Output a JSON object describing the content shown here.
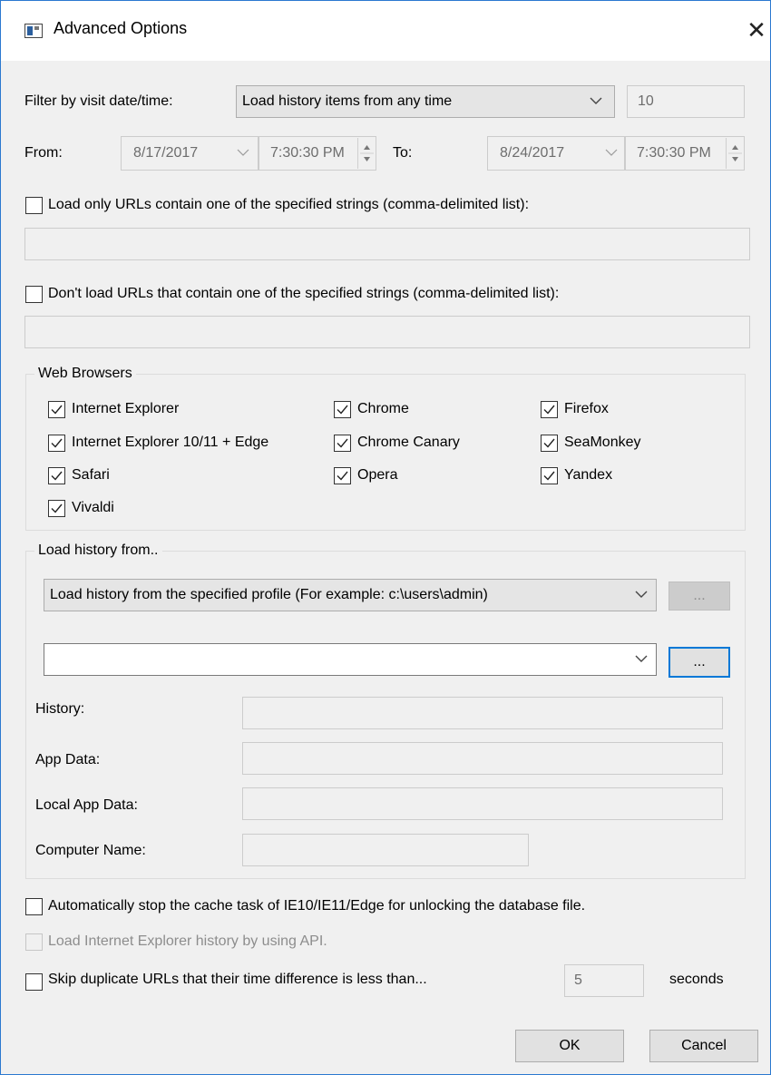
{
  "window": {
    "title": "Advanced Options",
    "close_glyph": "✕"
  },
  "filter": {
    "label": "Filter by visit date/time:",
    "selected": "Load history items from any time",
    "number_value": "10"
  },
  "range": {
    "from_label": "From:",
    "from_date": "8/17/2017",
    "from_time": "7:30:30 PM",
    "to_label": "To:",
    "to_date": "8/24/2017",
    "to_time": "7:30:30 PM"
  },
  "include_urls": {
    "label": "Load only URLs contain one of the specified strings (comma-delimited list):",
    "checked": false,
    "value": ""
  },
  "exclude_urls": {
    "label": "Don't load URLs that contain one of the specified strings (comma-delimited list):",
    "checked": false,
    "value": ""
  },
  "browsers": {
    "title": "Web Browsers",
    "items": [
      {
        "label": "Internet Explorer",
        "checked": true
      },
      {
        "label": "Chrome",
        "checked": true
      },
      {
        "label": "Firefox",
        "checked": true
      },
      {
        "label": "Internet Explorer 10/11 + Edge",
        "checked": true
      },
      {
        "label": "Chrome Canary",
        "checked": true
      },
      {
        "label": "SeaMonkey",
        "checked": true
      },
      {
        "label": "Safari",
        "checked": true
      },
      {
        "label": "Opera",
        "checked": true
      },
      {
        "label": "Yandex",
        "checked": true
      },
      {
        "label": "Vivaldi",
        "checked": true
      }
    ]
  },
  "load_from": {
    "title": "Load history from..",
    "source_selected": "Load history from the specified profile (For example: c:\\users\\admin)",
    "browse_label": "...",
    "profile_value": "",
    "history_label": "History:",
    "history_value": "",
    "appdata_label": "App Data:",
    "appdata_value": "",
    "localappdata_label": "Local App Data:",
    "localappdata_value": "",
    "computer_label": "Computer Name:",
    "computer_value": ""
  },
  "options": {
    "stop_cache": {
      "label": "Automatically stop the cache task of IE10/IE11/Edge for unlocking the database file.",
      "checked": false
    },
    "ie_api": {
      "label": "Load Internet Explorer history by using API.",
      "checked": false,
      "enabled": false
    },
    "skip_dupes": {
      "label": "Skip duplicate URLs that their time difference is less than...",
      "checked": false,
      "seconds_value": "5",
      "seconds_label": "seconds"
    }
  },
  "buttons": {
    "ok": "OK",
    "cancel": "Cancel"
  },
  "colors": {
    "accent": "#0078d7",
    "dialog_bg": "#f0f0f0",
    "border": "#2b79d0"
  }
}
